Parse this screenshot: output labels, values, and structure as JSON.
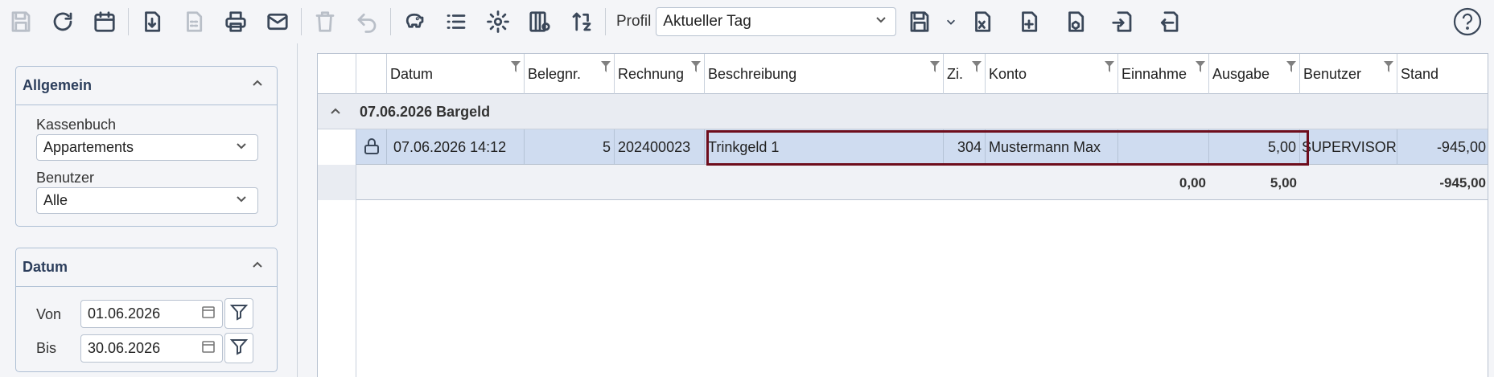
{
  "toolbar": {
    "profil_label": "Profil",
    "profil_value": "Aktueller Tag",
    "icons": [
      "save-icon",
      "refresh-icon",
      "calendar-icon",
      "download-icon",
      "document-icon",
      "print-icon",
      "mail-icon",
      "trash-icon",
      "undo-icon",
      "piggy-bank-icon",
      "list-icon",
      "gear-icon",
      "columns-settings-icon",
      "sort-icon",
      "save-profile-icon",
      "export-excel-icon",
      "new-document-icon",
      "package-document-icon",
      "import-icon",
      "export-icon",
      "help-icon"
    ]
  },
  "left": {
    "allgemein": {
      "title": "Allgemein",
      "kassenbuch_label": "Kassenbuch",
      "kassenbuch_value": "Appartements",
      "benutzer_label": "Benutzer",
      "benutzer_value": "Alle"
    },
    "datum": {
      "title": "Datum",
      "von_label": "Von",
      "von_value": "01.06.2026",
      "bis_label": "Bis",
      "bis_value": "30.06.2026"
    }
  },
  "grid": {
    "columns": [
      "Datum",
      "Belegnr.",
      "Rechnung",
      "Beschreibung",
      "Zi.",
      "Konto",
      "Einnahme",
      "Ausgabe",
      "Benutzer",
      "Stand"
    ],
    "group": "07.06.2026 Bargeld",
    "row": {
      "datum": "07.06.2026 14:12",
      "belegnr": "5",
      "rechnung": "202400023",
      "beschreibung": "Trinkgeld 1",
      "zi": "304",
      "konto": "Mustermann Max",
      "einnahme": "",
      "ausgabe": "5,00",
      "benutzer": "SUPERVISOR",
      "stand": "-945,00"
    },
    "sum": {
      "einnahme": "0,00",
      "ausgabe": "5,00",
      "stand": "-945,00"
    }
  },
  "colors": {
    "accent": "#2c3e5c",
    "selection": "#cfdcf0",
    "highlight_border": "#6e0d1c"
  }
}
